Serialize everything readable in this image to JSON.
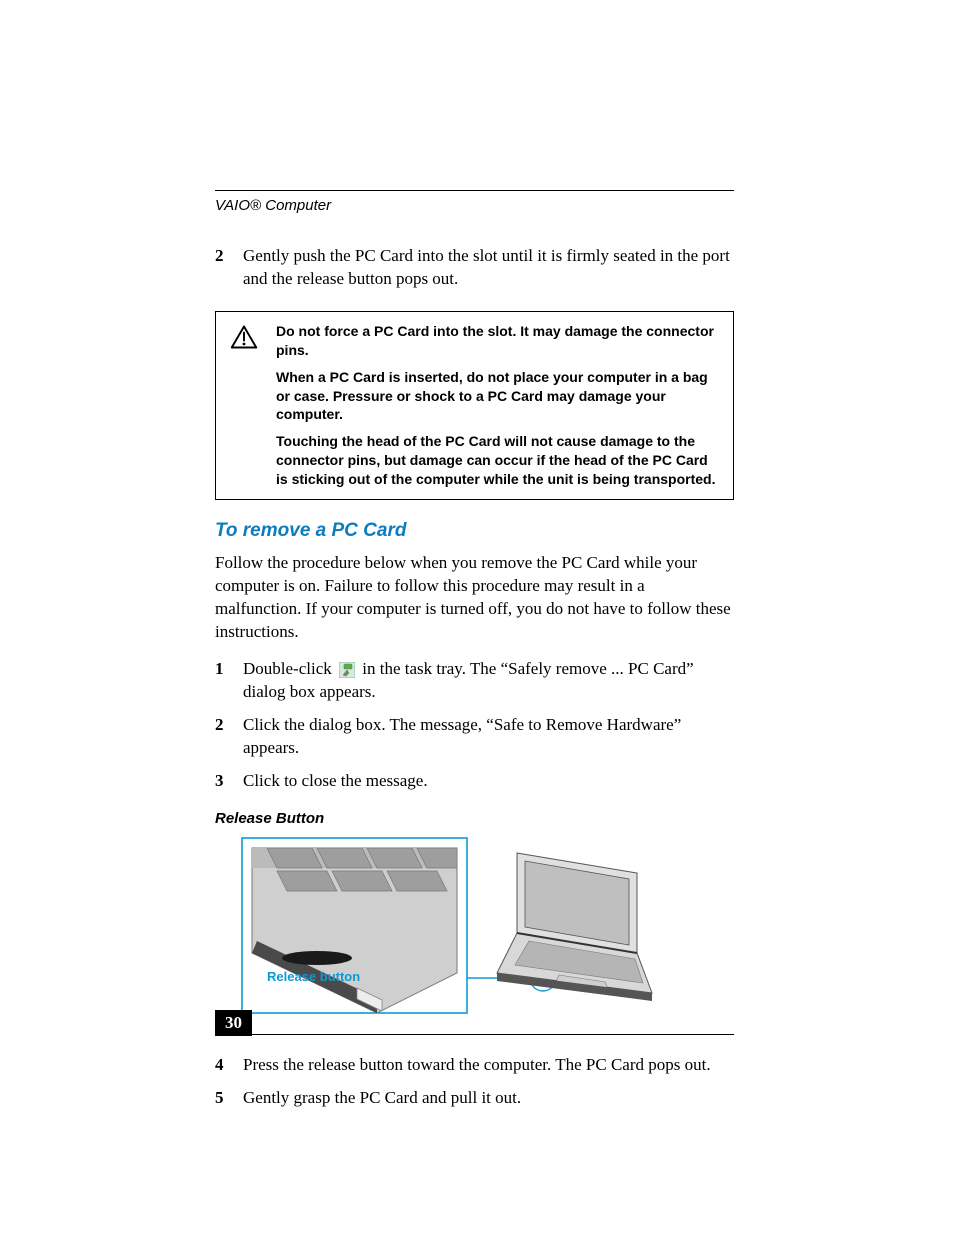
{
  "header": {
    "product": "VAIO® Computer"
  },
  "intro_steps": [
    {
      "n": "2",
      "text": "Gently push the PC Card into the slot until it is firmly seated in the port and the release button pops out."
    }
  ],
  "caution": {
    "p1": "Do not force a PC Card into the slot. It may damage the connector pins.",
    "p2": "When a PC Card is inserted, do not place your computer in a bag or case. Pressure or shock to a PC Card may damage your computer.",
    "p3": "Touching the head of the PC Card will not cause damage to the connector pins, but damage can occur if the head of the PC Card is sticking out of the computer while the unit is being transported."
  },
  "section_title": "To remove a PC Card",
  "section_intro": "Follow the procedure below when you remove the PC Card while your computer is on. Failure to follow this procedure may result in a malfunction. If your computer is turned off, you do not have to follow these instructions.",
  "steps_a": [
    {
      "n": "1",
      "pre": "Double-click ",
      "post": " in the task tray. The “Safely remove ... PC Card” dialog box appears."
    },
    {
      "n": "2",
      "pre": "",
      "post": "Click the dialog box. The message, “Safe to Remove Hardware” appears."
    },
    {
      "n": "3",
      "pre": "",
      "post": "Click to close the message."
    }
  ],
  "figure": {
    "caption": "Release Button",
    "callout": "Release button"
  },
  "steps_b": [
    {
      "n": "4",
      "text": "Press the release button toward the computer. The PC Card pops out."
    },
    {
      "n": "5",
      "text": "Gently grasp the PC Card and pull it out."
    }
  ],
  "page_number": "30",
  "icons": {
    "tray": "safely-remove-hardware-icon",
    "warn": "caution-icon"
  }
}
